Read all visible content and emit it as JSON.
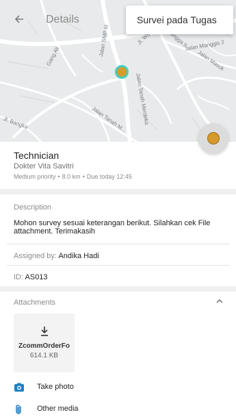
{
  "header": {
    "title": "Details",
    "back_icon": "arrow-left-icon",
    "menu": {
      "items": [
        "Survei pada Tugas"
      ]
    }
  },
  "map": {
    "street_labels": [
      "Gang Ali",
      "Jalan SMP III",
      "Jalan Tanah Merdeka",
      "Jalan Tanah M...",
      "Jl. Wijaya...",
      "Jl. Mangga II",
      "Mahkamah Agung",
      "Jalan Masuk",
      "Jalan Mpang...",
      "Jalan Manggis 2",
      "Jl. Bangka"
    ],
    "location_marker_color": "#d79b2a",
    "location_ring_color": "#3fcfc1",
    "fab_icon": "location-dot-icon"
  },
  "job": {
    "title": "Technician",
    "customer": "Dokter Vita Savitri",
    "priority": "Medium priority",
    "distance": "8.0 km",
    "due": "Due today 12:45",
    "separator": "•"
  },
  "description": {
    "label": "Description",
    "text": "Mohon survey sesuai keterangan berikut. Silahkan cek File attachment. Terimakasih"
  },
  "assigned": {
    "label": "Assigned by:",
    "value": "Andika Hadi"
  },
  "id_row": {
    "label": "ID:",
    "value": "AS013"
  },
  "attachments": {
    "label": "Attachments",
    "toggle_icon": "chevron-up-icon",
    "files": [
      {
        "name": "ZcommOrderFo",
        "size": "614.1 KB",
        "icon": "download-icon"
      }
    ]
  },
  "actions": [
    {
      "label": "Take photo",
      "icon": "camera-icon",
      "color": "#1e7fc4"
    },
    {
      "label": "Other media",
      "icon": "paperclip-icon",
      "color": "#1e7fc4"
    }
  ]
}
